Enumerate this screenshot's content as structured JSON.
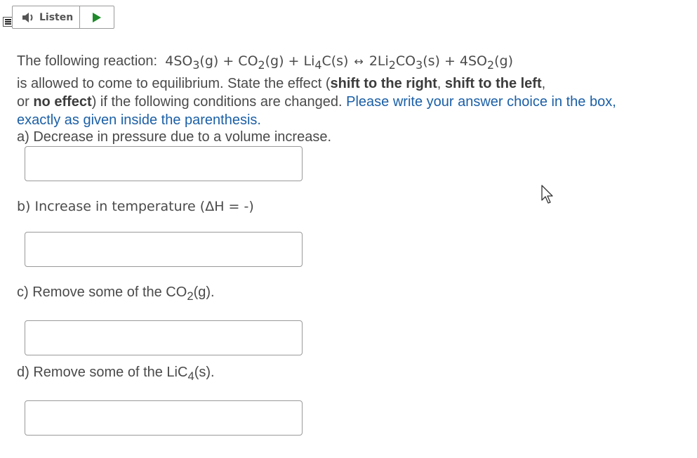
{
  "toolbar": {
    "listen_label": "Listen",
    "menu_icon": "menu-icon",
    "speaker_icon": "speaker-icon",
    "play_icon": "play-icon"
  },
  "question": {
    "reaction_intro": "The following reaction:",
    "reactants": {
      "r1": "4SO",
      "r1_sub": "3",
      "r1_state": "(g) + CO",
      "r2_sub": "2",
      "r2_state": "(g) + Li",
      "r3_sub": "4",
      "r3_tail": "C(s)"
    },
    "arrow": "↔",
    "products": {
      "p1": "2Li",
      "p1_sub": "2",
      "p1_mid": "CO",
      "p1_sub2": "3",
      "p1_tail": "(s) + 4SO",
      "p2_sub": "2",
      "p2_tail": "(g)"
    },
    "line2_a": "is allowed to come to equilibrium. State the effect (",
    "opt_right": "shift to the right",
    "comma1": ", ",
    "opt_left": "shift to the left",
    "comma2": ",",
    "line3_a": "or ",
    "opt_none": "no effect",
    "line3_b": ") if the following conditions are changed. ",
    "instruction": "Please write your answer choice in the box, exactly as given inside the parenthesis."
  },
  "parts": {
    "a": "a) Decrease in pressure due to a volume increase.",
    "b": "b) Increase in temperature (ΔH = -)",
    "c_pre": "c) Remove some of the CO",
    "c_sub": "2",
    "c_post": "(g).",
    "d_pre": "d) Remove some of the LiC",
    "d_sub": "4",
    "d_post": "(s)."
  },
  "answers": {
    "a": "",
    "b": "",
    "c": "",
    "d": ""
  }
}
